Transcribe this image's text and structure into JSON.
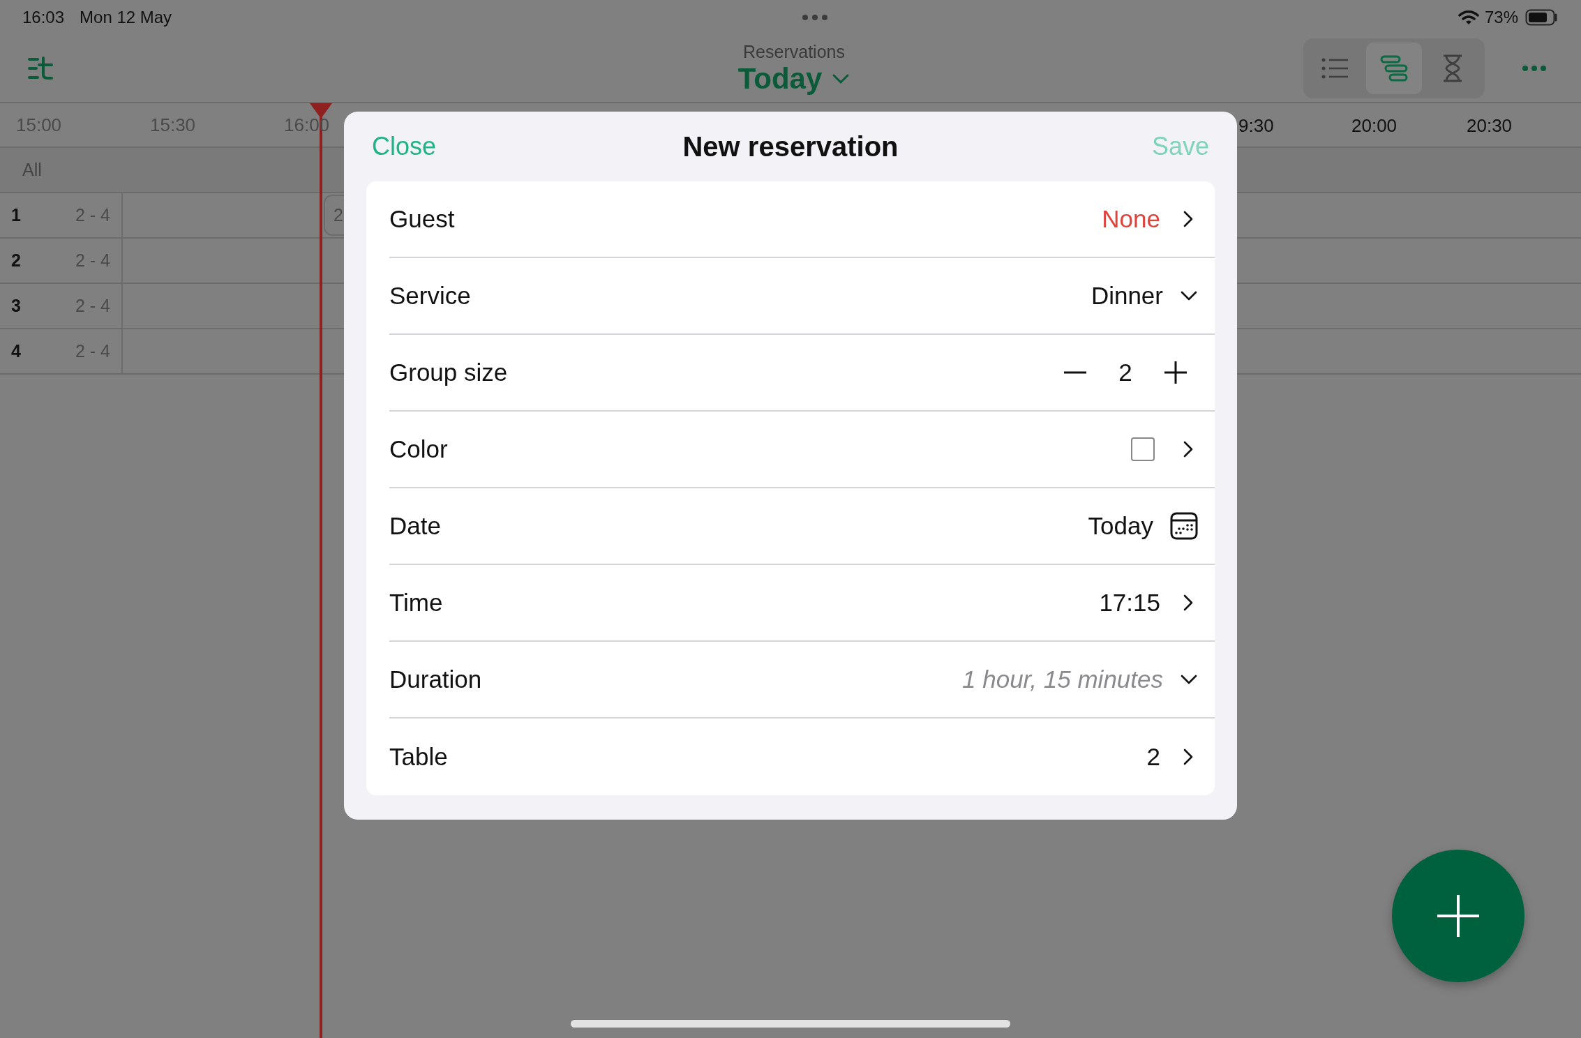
{
  "status_bar": {
    "time": "16:03",
    "date": "Mon 12 May",
    "battery": "73%"
  },
  "nav": {
    "subtitle": "Reservations",
    "title": "Today"
  },
  "view_modes": [
    {
      "kind": "list",
      "selected": false
    },
    {
      "kind": "timeline",
      "selected": true
    },
    {
      "kind": "waiting",
      "selected": false
    }
  ],
  "timeline": {
    "times_left": [
      "15:00",
      "15:30",
      "16:00"
    ],
    "times_right": [
      "9:30",
      "20:00",
      "20:30"
    ],
    "filter": "All",
    "tables": [
      {
        "number": "1",
        "capacity": "2 - 4",
        "booking": "2"
      },
      {
        "number": "2",
        "capacity": "2 - 4"
      },
      {
        "number": "3",
        "capacity": "2 - 4"
      },
      {
        "number": "4",
        "capacity": "2 - 4"
      }
    ]
  },
  "modal": {
    "close": "Close",
    "title": "New reservation",
    "save": "Save",
    "save_disabled": true,
    "fields": [
      {
        "kind": "link",
        "label": "Guest",
        "value": "None",
        "warning": true
      },
      {
        "kind": "menu",
        "label": "Service",
        "value": "Dinner"
      },
      {
        "kind": "stepper",
        "label": "Group size",
        "value": "2"
      },
      {
        "kind": "color",
        "label": "Color"
      },
      {
        "kind": "date",
        "label": "Date",
        "value": "Today"
      },
      {
        "kind": "link",
        "label": "Time",
        "value": "17:15"
      },
      {
        "kind": "menu",
        "label": "Duration",
        "value": "1 hour, 15 minutes",
        "muted": true
      },
      {
        "kind": "link",
        "label": "Table",
        "value": "2"
      }
    ]
  }
}
